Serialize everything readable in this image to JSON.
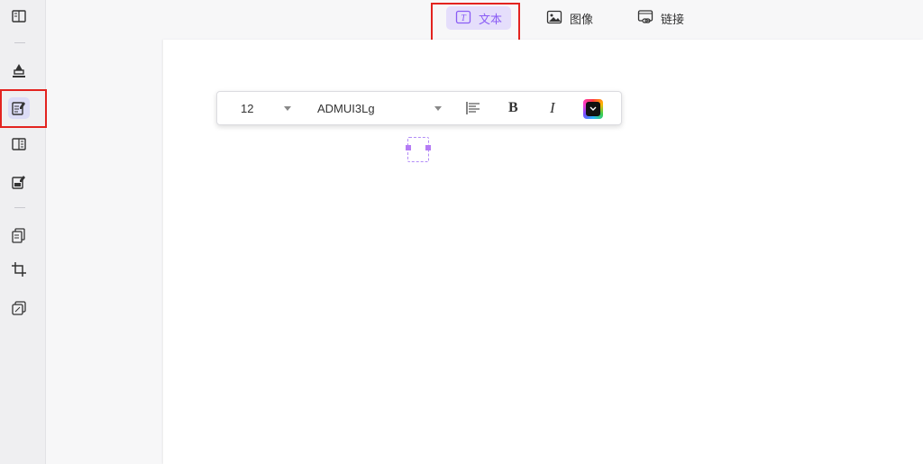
{
  "top_toolbar": {
    "items": [
      {
        "label": "文本",
        "icon": "text-icon",
        "active": true
      },
      {
        "label": "图像",
        "icon": "image-icon",
        "active": false
      },
      {
        "label": "链接",
        "icon": "link-icon",
        "active": false
      }
    ]
  },
  "sidebar": {
    "items": [
      {
        "icon": "reader-icon",
        "active": false
      },
      {
        "icon": "highlighter-icon",
        "active": false
      },
      {
        "icon": "edit-text-icon",
        "active": true
      },
      {
        "icon": "organize-pages-icon",
        "active": false
      },
      {
        "icon": "form-edit-icon",
        "active": false
      },
      {
        "icon": "convert-icon",
        "active": false
      },
      {
        "icon": "crop-icon",
        "active": false
      },
      {
        "icon": "batch-icon",
        "active": false
      }
    ]
  },
  "format_bar": {
    "font_size": "12",
    "font_name": "ADMUI3Lg",
    "bold_label": "B",
    "italic_label": "I"
  },
  "colors": {
    "accent": "#8a5cf5",
    "highlight_border": "#e3231f",
    "active_tab_bg": "#e5defb"
  }
}
